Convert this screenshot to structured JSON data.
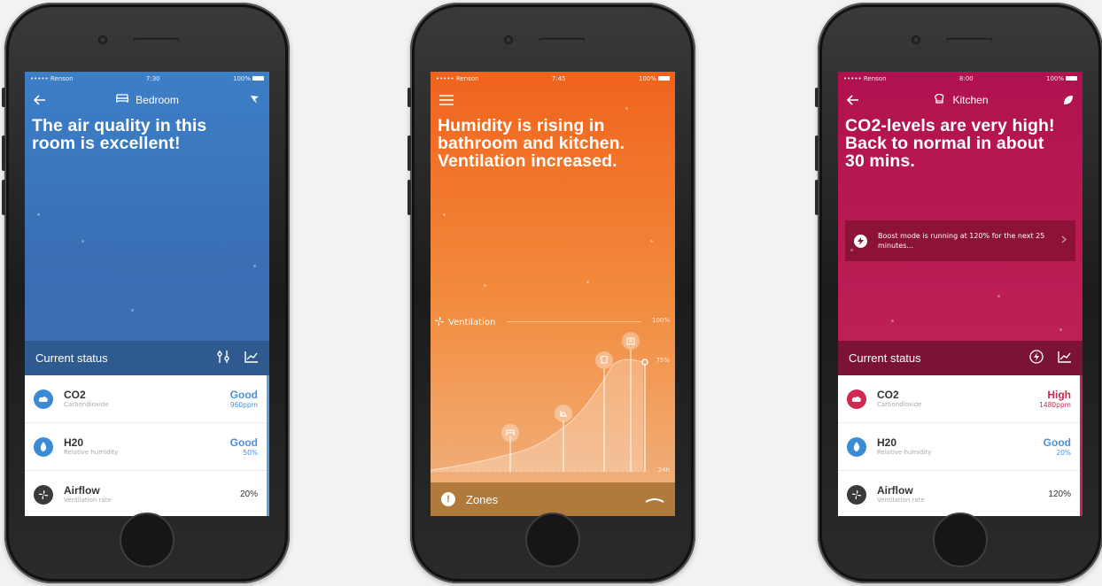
{
  "colors": {
    "blue_accent": "#4a90d9",
    "red_accent": "#d0284f",
    "orange_bg": "#f0631c",
    "magenta_bg": "#b0124f"
  },
  "screen1": {
    "status": {
      "carrier": "••••• Renson",
      "time": "7:30",
      "battery": "100%"
    },
    "nav": {
      "back_icon": "arrow-left-icon",
      "room_icon": "bed-icon",
      "title": "Bedroom",
      "right_icon": "fan-icon"
    },
    "headline": "The air quality in this room is excellent!",
    "panel": {
      "title": "Current status",
      "icons": [
        "sliders-icon",
        "chart-icon"
      ],
      "rows": [
        {
          "name": "CO2",
          "sub": "Carbondioxide",
          "value": "Good",
          "detail": "960ppm",
          "icon": "cloud-icon"
        },
        {
          "name": "H20",
          "sub": "Relative humidity",
          "value": "Good",
          "detail": "50%",
          "icon": "drop-icon"
        },
        {
          "name": "Airflow",
          "sub": "Ventilation rate",
          "value": "20%",
          "icon": "fan-icon"
        }
      ]
    }
  },
  "screen2": {
    "status": {
      "carrier": "••••• Renson",
      "time": "7:45",
      "battery": "100%"
    },
    "nav": {
      "menu_icon": "hamburger-icon"
    },
    "headline": "Humidity is rising in bathroom and kitchen. Ventilation increased.",
    "chart": {
      "label": "Ventilation",
      "max_label": "100%",
      "current_label": "75%",
      "min_label": "24h",
      "current_fraction": 0.75,
      "event_icons": [
        "bed-icon",
        "bath-icon",
        "kitchen-icon",
        "shower-icon"
      ]
    },
    "zones": {
      "label": "Zones",
      "icon": "alert-icon",
      "handle_icon": "chevron-up-icon"
    }
  },
  "screen3": {
    "status": {
      "carrier": "••••• Renson",
      "time": "8:00",
      "battery": "100%"
    },
    "nav": {
      "back_icon": "arrow-left-icon",
      "room_icon": "chef-hat-icon",
      "title": "Kitchen",
      "right_icon": "leaf-icon"
    },
    "headline": "CO2-levels are very high! Back to normal in about 30 mins.",
    "boost": "Boost mode is running at 120% for the next 25 minutes...",
    "panel": {
      "title": "Current status",
      "icons": [
        "boost-icon",
        "chart-icon"
      ],
      "rows": [
        {
          "name": "CO2",
          "sub": "Carbondioxide",
          "value": "High",
          "detail": "1480ppm",
          "icon": "cloud-icon"
        },
        {
          "name": "H20",
          "sub": "Relative humidity",
          "value": "Good",
          "detail": "20%",
          "icon": "drop-icon"
        },
        {
          "name": "Airflow",
          "sub": "Ventilation rate",
          "value": "120%",
          "icon": "fan-icon"
        }
      ]
    }
  }
}
